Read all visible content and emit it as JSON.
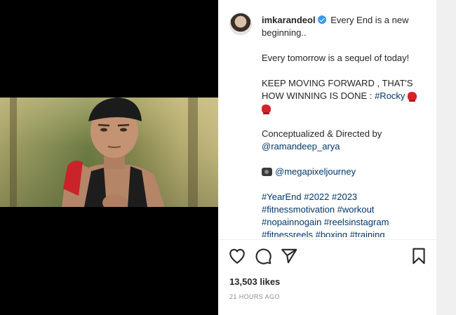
{
  "post": {
    "username": "imkarandeol",
    "caption_line1": "Every End is a new beginning..",
    "caption_line2": "Every tomorrow is a sequel of today!",
    "caption_line3": "KEEP MOVING FORWARD , THAT'S HOW WINNING IS DONE :",
    "caption_tag_rocky": "#Rocky",
    "caption_line4": "Conceptualized & Directed by",
    "mention_director": "@ramandeep_arya",
    "mention_camera": "@megapixeljourney",
    "hashtags_line1": "#YearEnd #2022 #2023",
    "hashtags_line2": "#fitnessmotivation #workout",
    "hashtags_line3": "#nopainnogain #reelsinstagram",
    "hashtags_line4": "#fitnessreels #boxing #training",
    "comment_time": "21h",
    "likes": "13,503 likes",
    "posted": "21 HOURS AGO"
  },
  "icons": {
    "like": "heart-icon",
    "comment": "comment-icon",
    "share": "send-icon",
    "save": "bookmark-icon",
    "verified": "verified-badge-icon",
    "glove": "boxing-glove-emoji",
    "camera": "video-camera-emoji"
  },
  "colors": {
    "link": "#00376b",
    "verified": "#3897f0",
    "muted": "#8e8e8e",
    "text": "#262626"
  }
}
